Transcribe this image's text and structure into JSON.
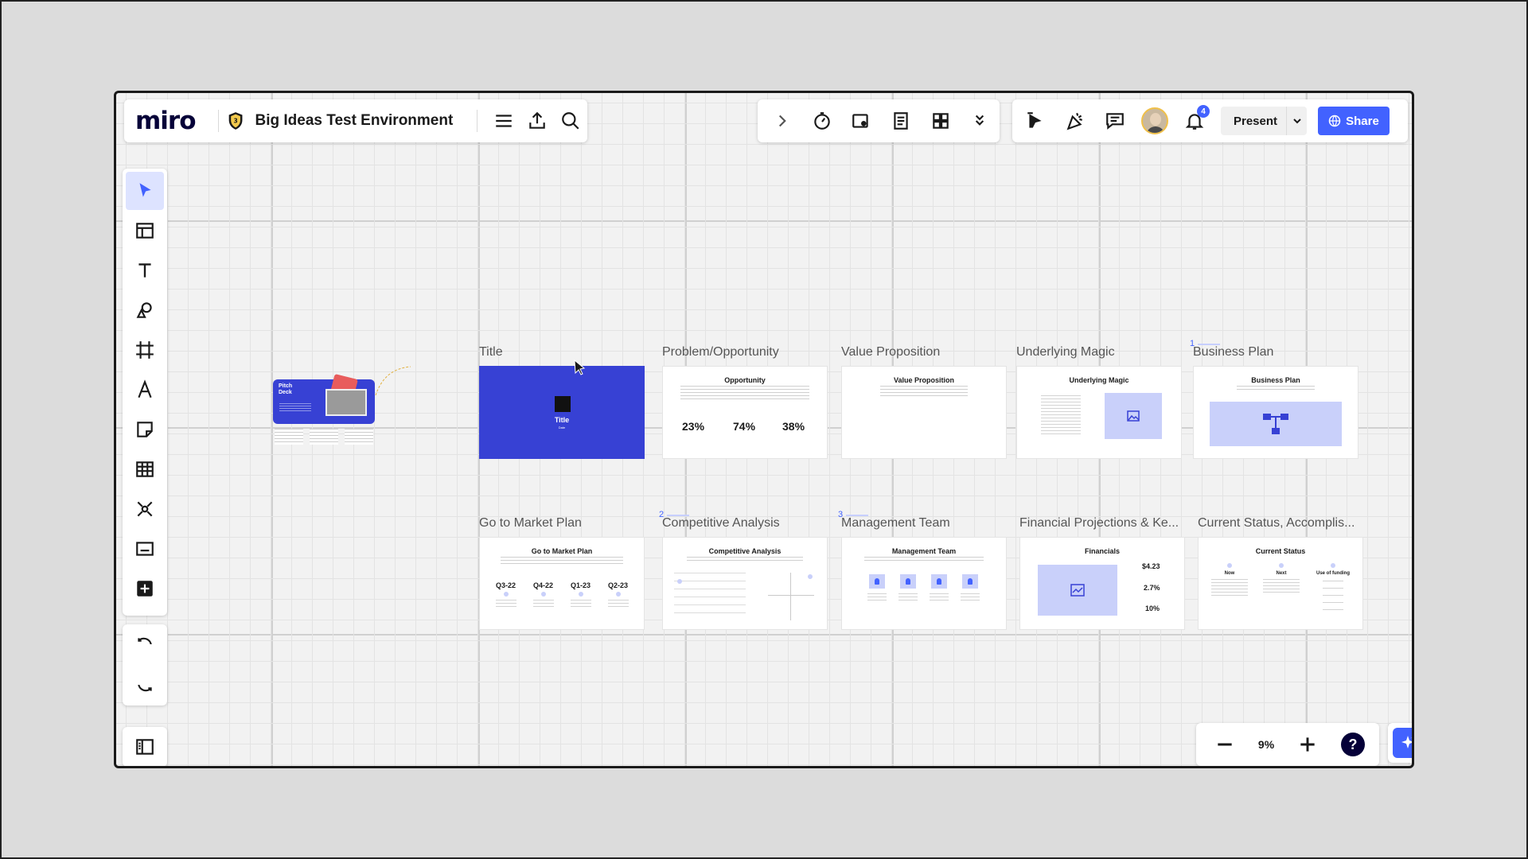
{
  "board": {
    "logo": "miro",
    "title": "Big Ideas Test Environment"
  },
  "toolbar_right": {
    "notification_count": "4",
    "present_label": "Present",
    "share_label": "Share"
  },
  "zoom": {
    "value": "9%",
    "help_label": "?"
  },
  "mini_deck": {
    "title_line1": "Pitch",
    "title_line2": "Deck"
  },
  "frames": {
    "title": {
      "label": "Title",
      "heading": "Title",
      "subtitle": "Date"
    },
    "problem": {
      "label": "Problem/Opportunity",
      "heading": "Opportunity",
      "stats": [
        "23%",
        "74%",
        "38%"
      ]
    },
    "value": {
      "label": "Value Proposition",
      "heading": "Value Proposition"
    },
    "magic": {
      "label": "Underlying Magic",
      "heading": "Underlying Magic"
    },
    "business": {
      "label": "Business Plan",
      "number": "1",
      "heading": "Business Plan"
    },
    "gtm": {
      "label": "Go to Market Plan",
      "heading": "Go to Market Plan",
      "quarters": [
        "Q3-22",
        "Q4-22",
        "Q1-23",
        "Q2-23"
      ]
    },
    "competitive": {
      "label": "Competitive Analysis",
      "number": "2",
      "heading": "Competitive Analysis"
    },
    "team": {
      "label": "Management Team",
      "number": "3",
      "heading": "Management Team"
    },
    "financial": {
      "label": "Financial Projections & Ke...",
      "heading": "Financials",
      "values": [
        "$4.23",
        "2.7%",
        "10%"
      ]
    },
    "status": {
      "label": "Current Status, Accomplis...",
      "heading": "Current Status",
      "columns": [
        "Now",
        "Next",
        "Use of funding"
      ]
    }
  },
  "colors": {
    "accent": "#4262ff",
    "title_slide": "#3741d4",
    "placeholder": "#c9d0fa"
  }
}
